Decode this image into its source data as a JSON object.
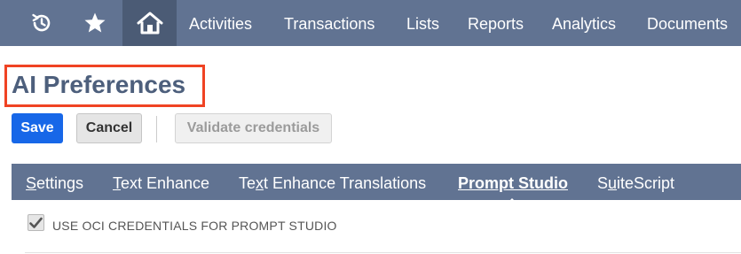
{
  "nav": {
    "icons": [
      "history-icon",
      "star-icon",
      "home-icon"
    ],
    "items": [
      "Activities",
      "Transactions",
      "Lists",
      "Reports",
      "Analytics",
      "Documents"
    ]
  },
  "page": {
    "title": "AI Preferences"
  },
  "buttons": {
    "save": "Save",
    "cancel": "Cancel",
    "validate": "Validate credentials"
  },
  "tabs": [
    {
      "prefix": "",
      "accel": "S",
      "rest": "ettings"
    },
    {
      "prefix": "",
      "accel": "T",
      "rest": "ext Enhance"
    },
    {
      "prefix": "Te",
      "accel": "x",
      "rest": "t Enhance Translations"
    },
    {
      "prefix": "",
      "accel": "",
      "rest": "Prompt Studio"
    },
    {
      "prefix": "S",
      "accel": "u",
      "rest": "iteScript"
    }
  ],
  "active_tab": "Prompt Studio",
  "checkbox": {
    "label": "USE OCI CREDENTIALS FOR PROMPT STUDIO",
    "checked": true
  },
  "colors": {
    "nav_bg": "#617392",
    "nav_active_bg": "#4b5b75",
    "title": "#4d5f7c",
    "save_bg": "#1767e8",
    "highlight_box": "#f04323"
  }
}
